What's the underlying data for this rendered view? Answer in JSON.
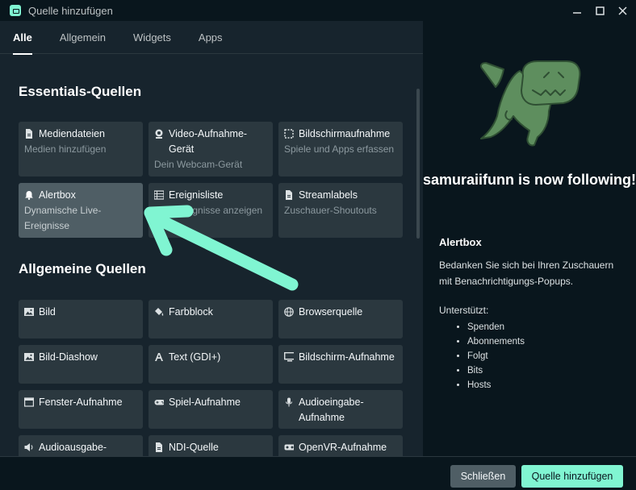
{
  "window": {
    "title": "Quelle hinzufügen",
    "controls": [
      "minimize-icon",
      "maximize-icon",
      "close-icon"
    ]
  },
  "tabs": [
    {
      "label": "Alle",
      "active": true
    },
    {
      "label": "Allgemein",
      "active": false
    },
    {
      "label": "Widgets",
      "active": false
    },
    {
      "label": "Apps",
      "active": false
    }
  ],
  "sections": {
    "essentials": "Essentials-Quellen",
    "general": "Allgemeine Quellen"
  },
  "essentials": [
    {
      "title": "Mediendateien",
      "desc": "Medien hinzufügen",
      "icon": "file-icon"
    },
    {
      "title": "Video-Aufnahme-Gerät",
      "desc": "Dein Webcam-Gerät",
      "icon": "webcam-icon"
    },
    {
      "title": "Bildschirmaufnahme",
      "desc": "Spiele und Apps erfassen",
      "icon": "screen-capture-icon"
    },
    {
      "title": "Alertbox",
      "desc": "Dynamische Live-Ereignisse",
      "icon": "bell-icon",
      "selected": true
    },
    {
      "title": "Ereignisliste",
      "desc": "Live-Ereignisse anzeigen",
      "icon": "list-icon"
    },
    {
      "title": "Streamlabels",
      "desc": "Zuschauer-Shoutouts",
      "icon": "file-icon"
    }
  ],
  "general": [
    {
      "title": "Bild",
      "icon": "image-icon"
    },
    {
      "title": "Farbblock",
      "icon": "paint-bucket-icon"
    },
    {
      "title": "Browserquelle",
      "icon": "globe-icon"
    },
    {
      "title": "Bild-Diashow",
      "icon": "image-icon"
    },
    {
      "title": "Text (GDI+)",
      "icon": "text-icon"
    },
    {
      "title": "Bildschirm-Aufnahme",
      "icon": "monitor-icon"
    },
    {
      "title": "Fenster-Aufnahme",
      "icon": "window-icon"
    },
    {
      "title": "Spiel-Aufnahme",
      "icon": "gamepad-icon"
    },
    {
      "title": "Audioeingabe-Aufnahme",
      "icon": "microphone-icon"
    },
    {
      "title": "Audioausgabe-",
      "icon": "speaker-icon"
    },
    {
      "title": "NDI-Quelle",
      "icon": "file-icon"
    },
    {
      "title": "OpenVR-Aufnahme",
      "icon": "vr-headset-icon"
    }
  ],
  "preview": {
    "follow_text": "samuraiifunn is now following!",
    "info_title": "Alertbox",
    "info_desc": "Bedanken Sie sich bei Ihren Zuschauern mit Benachrichtigungs-Popups.",
    "supported_label": "Unterstützt:",
    "supported": [
      "Spenden",
      "Abonnements",
      "Folgt",
      "Bits",
      "Hosts"
    ]
  },
  "footer": {
    "close_label": "Schließen",
    "add_label": "Quelle hinzufügen"
  },
  "colors": {
    "accent": "#80f5d2",
    "background": "#17242d",
    "panel": "#09161d",
    "tile": "#2b383f",
    "tile_selected": "#4f5e65",
    "dino": "#5e8e5e"
  }
}
